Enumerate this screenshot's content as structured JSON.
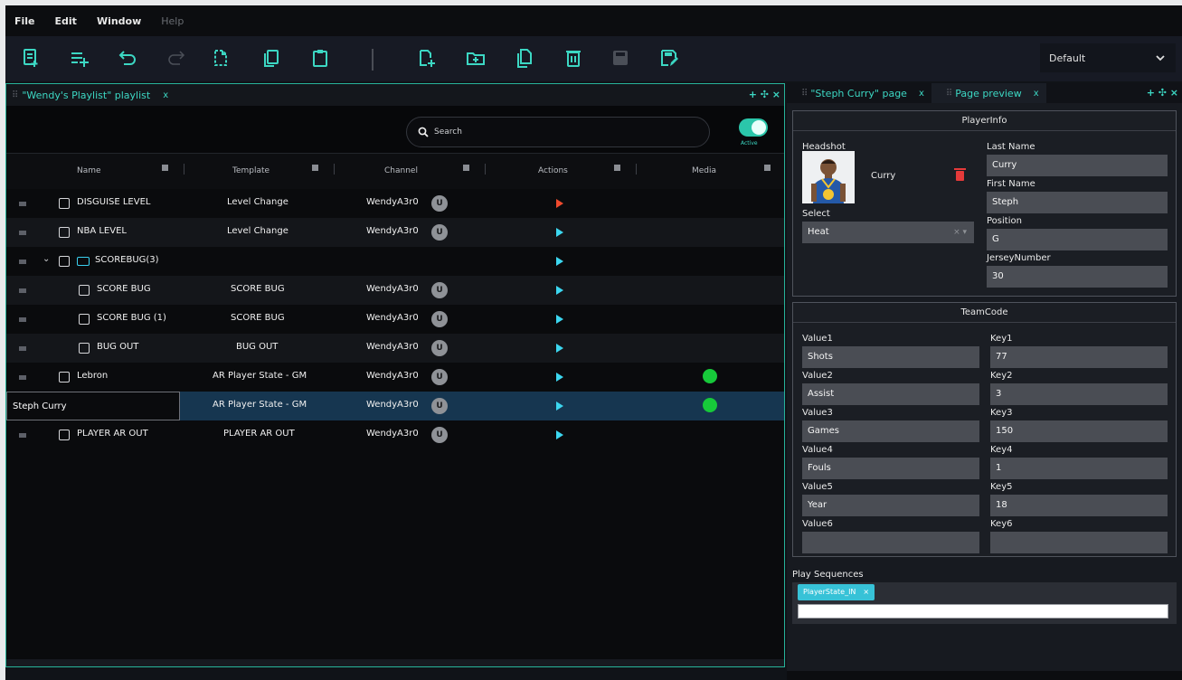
{
  "menu": [
    "File",
    "Edit",
    "Window",
    "Help"
  ],
  "menu_help_disabled": true,
  "toolbar": {
    "workspace_value": "Default",
    "buttons": [
      "new-item-icon",
      "add-list-icon",
      "undo-icon",
      "redo-icon",
      "new-page-icon",
      "copy-icon",
      "paste-icon",
      "new-template-icon",
      "new-folder-icon",
      "duplicate-icon",
      "delete-icon",
      "save-icon",
      "save-as-icon"
    ]
  },
  "playlist_panel": {
    "tab_label": "\"Wendy's Playlist\" playlist",
    "tab_close": "x",
    "panel_icons": "+ ✣ ×",
    "search_placeholder": "Search",
    "toggle_label": "Active",
    "columns": [
      "Name",
      "Template",
      "Channel",
      "Actions",
      "Media"
    ],
    "rows": [
      {
        "name": "DISGUISE LEVEL",
        "template": "Level Change",
        "channel": "WendyA3r0",
        "action": "red",
        "media": false
      },
      {
        "name": "NBA LEVEL",
        "template": "Level Change",
        "channel": "WendyA3r0",
        "action": "blue",
        "media": false
      },
      {
        "name": "SCOREBUG",
        "count": "(3)",
        "template": "",
        "channel": "",
        "action": "blue",
        "media": false,
        "folder": true
      },
      {
        "name": "SCORE BUG",
        "template": "SCORE BUG",
        "channel": "WendyA3r0",
        "action": "blue",
        "media": false
      },
      {
        "name": "SCORE BUG (1)",
        "template": "SCORE BUG",
        "channel": "WendyA3r0",
        "action": "blue",
        "media": false
      },
      {
        "name": "BUG OUT",
        "template": "BUG OUT",
        "channel": "WendyA3r0",
        "action": "blue",
        "media": false
      },
      {
        "name": "Lebron",
        "template": "AR Player State - GM",
        "channel": "WendyA3r0",
        "action": "blue",
        "media": true
      },
      {
        "name": "Steph Curry",
        "template": "AR Player State - GM",
        "channel": "WendyA3r0",
        "action": "blue",
        "media": true,
        "editing": true
      },
      {
        "name": "PLAYER AR OUT",
        "template": "PLAYER AR OUT",
        "channel": "WendyA3r0",
        "action": "blue",
        "media": false
      }
    ]
  },
  "page_panel": {
    "tab1_label": "\"Steph Curry\" page",
    "tab2_label": "Page preview",
    "tab_close": "x",
    "panel_icons": "+ ✣ ×",
    "playerinfo": {
      "title": "PlayerInfo",
      "headshot_label": "Headshot",
      "headshot_name": "Curry",
      "select_label": "Select",
      "select_value": "Heat",
      "select_clear": "× ▾",
      "last_name_label": "Last Name",
      "last_name_value": "Curry",
      "first_name_label": "First Name",
      "first_name_value": "Steph",
      "position_label": "Position",
      "position_value": "G",
      "jersey_label": "JerseyNumber",
      "jersey_value": "30"
    },
    "teamcode": {
      "title": "TeamCode",
      "fields": [
        {
          "vlabel": "Value1",
          "value": "Shots",
          "klabel": "Key1",
          "key": "77"
        },
        {
          "vlabel": "Value2",
          "value": "Assist",
          "klabel": "Key2",
          "key": "3"
        },
        {
          "vlabel": "Value3",
          "value": "Games",
          "klabel": "Key3",
          "key": "150"
        },
        {
          "vlabel": "Value4",
          "value": "Fouls",
          "klabel": "Key4",
          "key": "1"
        },
        {
          "vlabel": "Value5",
          "value": "Year",
          "klabel": "Key5",
          "key": "18"
        },
        {
          "vlabel": "Value6",
          "value": "",
          "klabel": "Key6",
          "key": ""
        }
      ]
    },
    "play_sequences_label": "Play Sequences",
    "sequence_chip": "PlayerState_IN",
    "chip_close": "×"
  },
  "colors": {
    "accent": "#3cd7c3",
    "play": "#3cd7f0",
    "play_alert": "#ef4a2d",
    "media_ok": "#17c93a",
    "selected_row": "#163650",
    "delete": "#e53a3a"
  }
}
